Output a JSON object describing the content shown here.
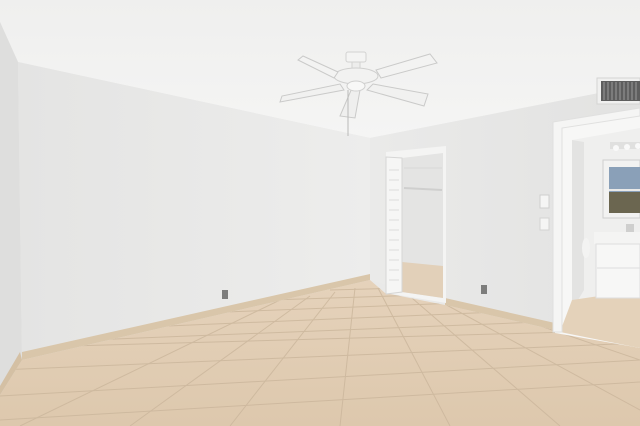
{
  "scene": {
    "subject": "empty-bedroom",
    "colors": {
      "ceiling": "#f1f1f0",
      "wall_left": "#e8e8e7",
      "wall_back": "#ececeb",
      "wall_right": "#e6e6e5",
      "floor_tile": "#e3cfb6",
      "grout": "#cdb89e",
      "baseboard": "#d8c4a8",
      "door_frame": "#f4f4f3",
      "vent": "#6a6a6a",
      "window_sky": "#8aa0b8"
    },
    "objects": [
      "ceiling-fan",
      "closet-bifold-door",
      "bathroom-doorway",
      "bathroom-vanity",
      "bathroom-window",
      "air-vent",
      "electrical-outlet",
      "light-switch"
    ]
  }
}
